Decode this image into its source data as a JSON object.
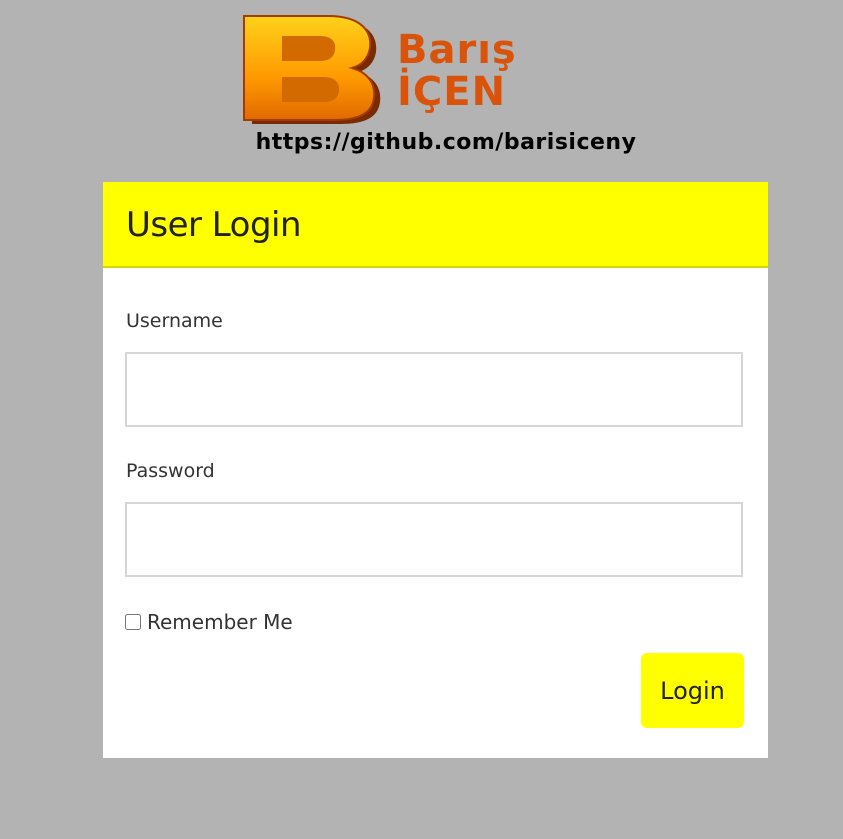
{
  "brand": {
    "logo_letter": "B",
    "name_line1": "Barış",
    "name_line2": "İÇEN",
    "url": "https://github.com/barisiceny"
  },
  "colors": {
    "background": "#b3b3b3",
    "accent": "#ffff00",
    "brand_orange": "#d9530a"
  },
  "login_form": {
    "title": "User Login",
    "username": {
      "label": "Username",
      "value": "",
      "placeholder": ""
    },
    "password": {
      "label": "Password",
      "value": "",
      "placeholder": ""
    },
    "remember_me": {
      "label": "Remember Me",
      "checked": false
    },
    "submit_label": "Login"
  }
}
